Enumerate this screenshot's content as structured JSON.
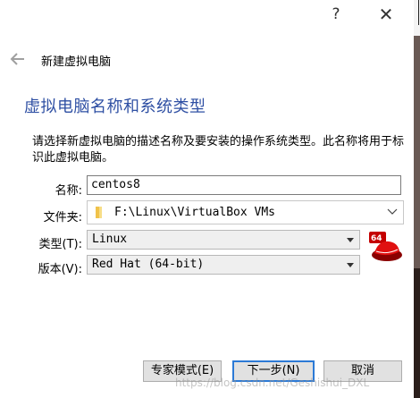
{
  "titlebar": {
    "help_label": "?",
    "close_label": "✕"
  },
  "wizard": {
    "title": "新建虚拟电脑",
    "heading": "虚拟电脑名称和系统类型",
    "description": "请选择新虚拟电脑的描述名称及要安装的操作系统类型。此名称将用于标识此虚拟电脑。"
  },
  "form": {
    "name_label": "名称:",
    "name_value": "centos8",
    "folder_label": "文件夹:",
    "folder_value": "F:\\Linux\\VirtualBox VMs",
    "type_label": "类型(T):",
    "type_value": "Linux",
    "version_label": "版本(V):",
    "version_value": "Red Hat (64-bit)",
    "os_badge": "64"
  },
  "buttons": {
    "expert": "专家模式(E)",
    "next": "下一步(N)",
    "cancel": "取消"
  },
  "watermark": "https://blog.csdn.net/Geshishui_DXL",
  "colors": {
    "heading": "#2e4fa3",
    "default_button_border": "#2c7ad6"
  }
}
